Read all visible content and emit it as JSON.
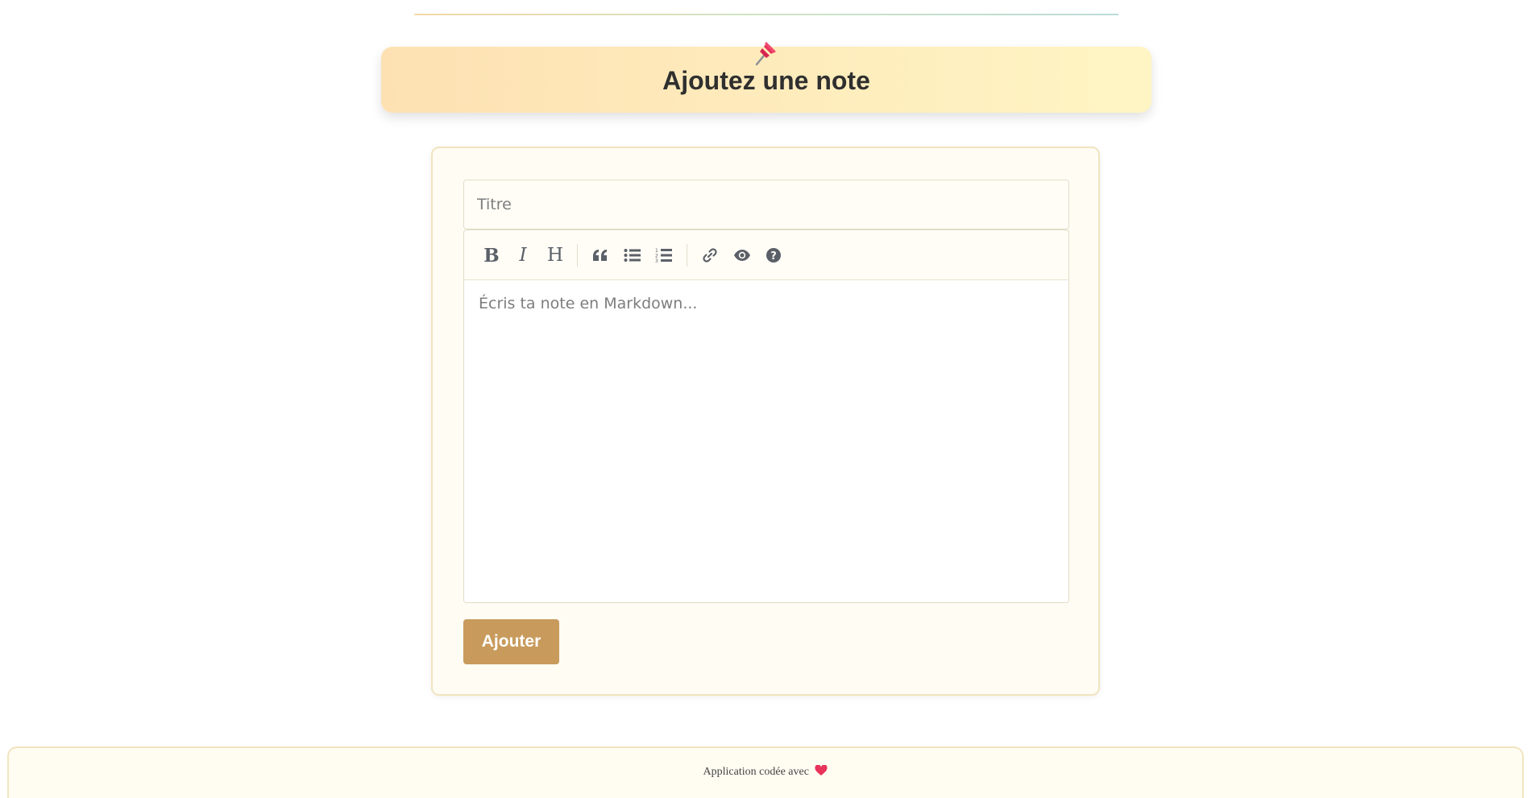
{
  "header": {
    "title": "Ajoutez une note",
    "pin_icon": "pushpin-icon",
    "gradient": [
      "#fde1b3",
      "#fff5c4"
    ]
  },
  "form": {
    "title_placeholder": "Titre",
    "title_value": "",
    "editor_placeholder": "Écris ta note en Markdown...",
    "editor_value": "",
    "submit_label": "Ajouter",
    "submit_color": "#c89b5c"
  },
  "toolbar": {
    "buttons": [
      {
        "name": "bold-icon",
        "glyph": "B"
      },
      {
        "name": "italic-icon",
        "glyph": "I"
      },
      {
        "name": "heading-icon",
        "glyph": "H"
      },
      {
        "name": "quote-icon"
      },
      {
        "name": "unordered-list-icon"
      },
      {
        "name": "ordered-list-icon"
      },
      {
        "name": "link-icon"
      },
      {
        "name": "preview-eye-icon"
      },
      {
        "name": "help-icon"
      }
    ]
  },
  "footer": {
    "text": "Application codée avec",
    "heart_icon": "heart-icon",
    "heart_color": "#e8335a"
  }
}
